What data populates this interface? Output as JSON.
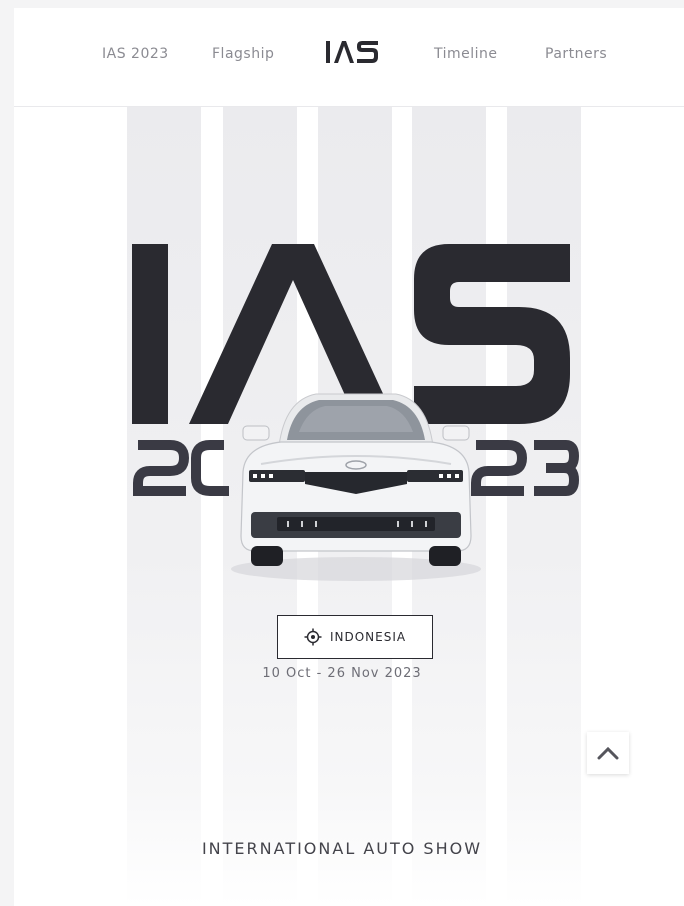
{
  "nav": {
    "items": [
      {
        "label": "IAS 2023"
      },
      {
        "label": "Flagship"
      },
      {
        "label": "Timeline"
      },
      {
        "label": "Partners"
      }
    ],
    "logo": "IAS"
  },
  "hero": {
    "title_top": "IAS",
    "title_year": "2023",
    "location": "INDONESIA",
    "date": "10 Oct - 26 Nov 2023",
    "tagline": "INTERNATIONAL AUTO SHOW"
  },
  "colors": {
    "brand_dark": "#2a2a30",
    "muted_text": "#8b8b92",
    "stripe": "#ebebee"
  },
  "icons": {
    "location": "crosshair-icon",
    "scroll_top": "chevron-up-icon"
  }
}
